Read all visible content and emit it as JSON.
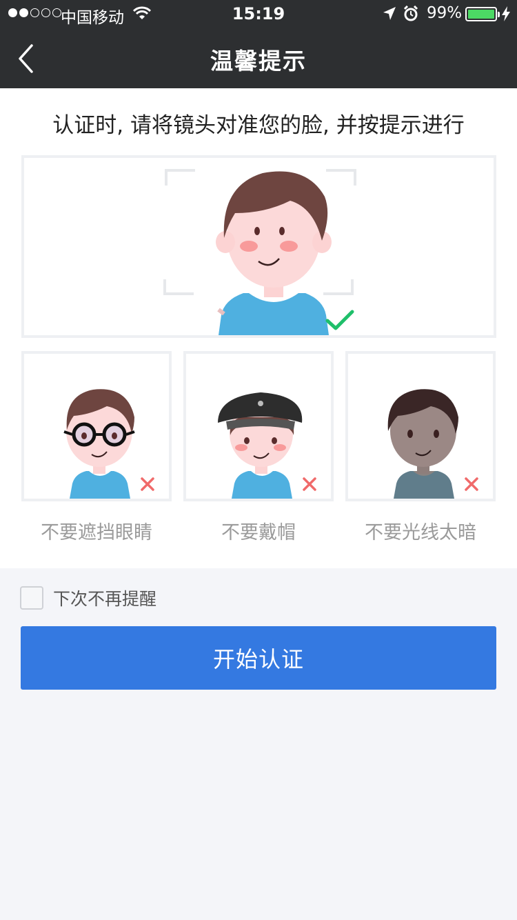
{
  "status_bar": {
    "carrier": "中国移动",
    "time": "15:19",
    "battery": "99%",
    "signal_bars_filled": 2,
    "signal_bars_total": 5,
    "icons": [
      "wifi-icon",
      "location-arrow-icon",
      "alarm-clock-icon",
      "battery-icon",
      "charging-bolt-icon"
    ],
    "battery_color": "#4cd964"
  },
  "nav": {
    "title": "温馨提示",
    "back_icon": "chevron-left-icon"
  },
  "instruction": "认证时, 请将镜头对准您的脸, 并按提示进行",
  "examples": {
    "correct": {
      "icon": "checkmark-icon",
      "color": "#1fbf6a"
    },
    "wrong": [
      {
        "caption": "不要遮挡眼睛",
        "icon": "cross-icon"
      },
      {
        "caption": "不要戴帽",
        "icon": "cross-icon"
      },
      {
        "caption": "不要光线太暗",
        "icon": "cross-icon"
      }
    ],
    "wrong_color": "#f06a6a"
  },
  "remember": {
    "label": "下次不再提醒",
    "checked": false
  },
  "start_button": {
    "label": "开始认证",
    "color": "#3479e1"
  }
}
